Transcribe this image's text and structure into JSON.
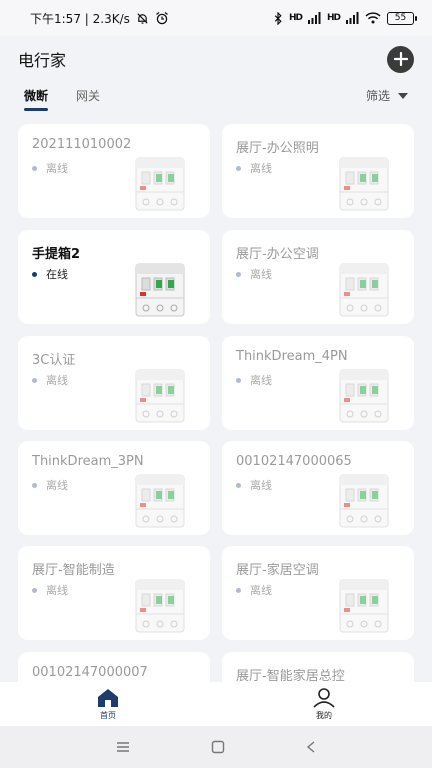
{
  "status_bar": {
    "time_speed": "下午1:57 | 2.3K/s",
    "mute_icon": "bell-off-icon",
    "alarm_icon": "alarm-icon",
    "bluetooth_icon": "bluetooth-icon",
    "signal_label": "HD",
    "wifi_icon": "wifi-icon",
    "battery": "55"
  },
  "header": {
    "title": "电行家",
    "add_icon": "plus-circle-icon"
  },
  "tabs": [
    {
      "label": "微断",
      "active": true
    },
    {
      "label": "网关",
      "active": false
    }
  ],
  "filter": {
    "label": "筛选"
  },
  "devices": [
    {
      "name": "202111010002",
      "status": "离线",
      "online": false
    },
    {
      "name": "展厅-办公照明",
      "status": "离线",
      "online": false
    },
    {
      "name": "手提箱2",
      "status": "在线",
      "online": true
    },
    {
      "name": "展厅-办公空调",
      "status": "离线",
      "online": false
    },
    {
      "name": "3C认证",
      "status": "离线",
      "online": false
    },
    {
      "name": "ThinkDream_4PN",
      "status": "离线",
      "online": false
    },
    {
      "name": "ThinkDream_3PN",
      "status": "离线",
      "online": false
    },
    {
      "name": "00102147000065",
      "status": "离线",
      "online": false
    },
    {
      "name": "展厅-智能制造",
      "status": "离线",
      "online": false
    },
    {
      "name": "展厅-家居空调",
      "status": "离线",
      "online": false
    },
    {
      "name": "00102147000007",
      "status": "",
      "online": false
    },
    {
      "name": "展厅-智能家居总控",
      "status": "",
      "online": false
    }
  ],
  "bottom_tabs": [
    {
      "label": "首页",
      "icon": "home-icon",
      "active": true
    },
    {
      "label": "我的",
      "icon": "user-icon",
      "active": false
    }
  ],
  "nav_bar": {
    "menu_icon": "menu-icon",
    "home_icon": "square-home-icon",
    "back_icon": "back-icon"
  },
  "colors": {
    "accent": "#1f3b6e",
    "offline_dot": "#aebcd0",
    "breaker_green": "#2fa84f",
    "breaker_red": "#d9342b"
  }
}
